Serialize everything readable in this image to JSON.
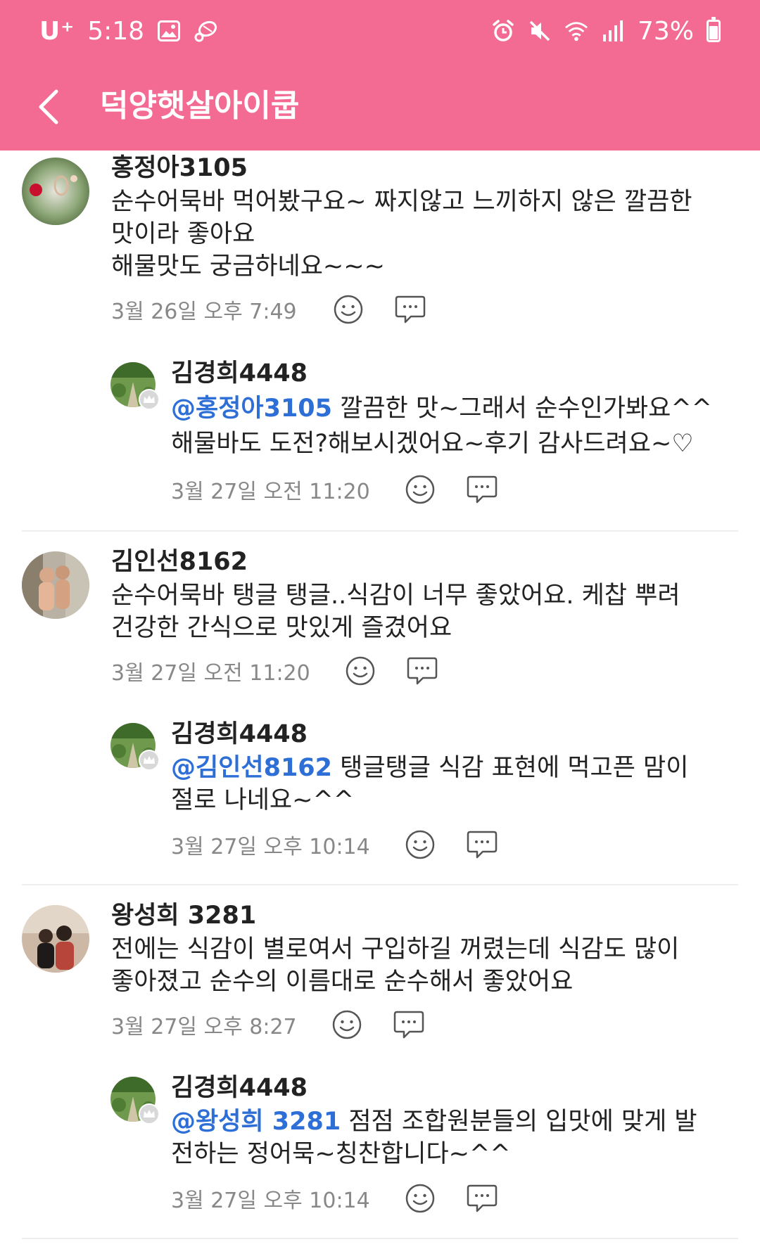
{
  "status_bar": {
    "carrier": "U⁺",
    "time": "5:18",
    "battery": "73%",
    "battery_level": 0.73,
    "icons": [
      "gallery-icon",
      "app-notification-icon",
      "alarm-icon",
      "mute-icon",
      "wifi-icon",
      "signal-icon",
      "battery-icon"
    ]
  },
  "app_bar": {
    "title": "덕양햇살아이쿱",
    "back_icon": "chevron-left-icon"
  },
  "colors": {
    "header": "#f36b93",
    "mention": "#2d6fd6",
    "date": "#888888",
    "text": "#222222"
  },
  "comments": [
    {
      "author": "홍정아3105",
      "text": "순수어묵바 먹어봤구요~ 짜지않고 느끼하지 않은 깔끔한\n맛이라 좋아요\n해물맛도 궁금하네요~~~",
      "date": "3월 26일 오후 7:49",
      "reply": {
        "author": "김경희4448",
        "mention": "@홍정아3105",
        "text": " 깔끔한 맛~그래서 순수인가봐요^^\n해물바도 도전?해보시겠어요~후기 감사드려요~♡",
        "date": "3월 27일 오전 11:20"
      }
    },
    {
      "author": "김인선8162",
      "text": "순수어묵바 탱글 탱글..식감이 너무 좋았어요. 케찹 뿌려\n건강한 간식으로 맛있게 즐겼어요",
      "date": "3월 27일 오전 11:20",
      "reply": {
        "author": "김경희4448",
        "mention": "@김인선8162",
        "text": " 탱글탱글 식감 표현에 먹고픈 맘이\n절로 나네요~^^",
        "date": "3월 27일 오후 10:14"
      }
    },
    {
      "author": "왕성희 3281",
      "text": "전에는 식감이 별로여서 구입하길 꺼렸는데 식감도  많이\n좋아졌고 순수의 이름대로 순수해서 좋았어요",
      "date": "3월 27일 오후 8:27",
      "reply": {
        "author": "김경희4448",
        "mention": "@왕성희 3281",
        "text": " 점점 조합원분들의 입맛에 맞게 발\n전하는 정어묵~칭찬합니다~^^",
        "date": "3월 27일 오후 10:14"
      }
    }
  ]
}
